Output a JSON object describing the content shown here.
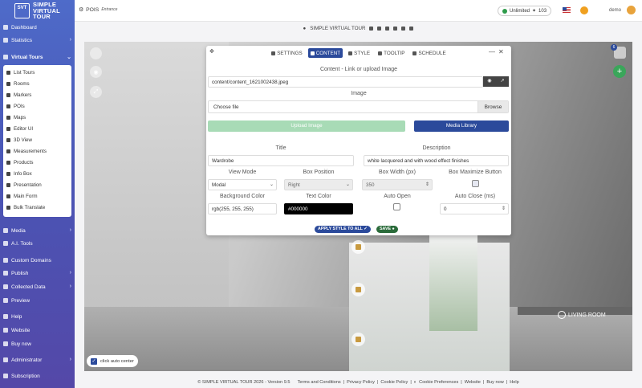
{
  "brand": {
    "logo": "SVT",
    "line1": "SIMPLE",
    "line2": "VIRTUAL",
    "line3": "TOUR"
  },
  "sidebar": {
    "items": [
      {
        "label": "Dashboard",
        "icon": "dashboard-icon"
      },
      {
        "label": "Statistics",
        "icon": "statistics-icon"
      },
      {
        "label": "Virtual Tours",
        "icon": "virtual-tours-icon"
      },
      {
        "label": "Media",
        "icon": "media-icon"
      },
      {
        "label": "A.I. Tools",
        "icon": "ai-tools-icon"
      },
      {
        "label": "Custom Domains",
        "icon": "globe-icon"
      },
      {
        "label": "Publish",
        "icon": "publish-icon"
      },
      {
        "label": "Collected Data",
        "icon": "collected-data-icon"
      },
      {
        "label": "Preview",
        "icon": "eye-icon"
      },
      {
        "label": "Help",
        "icon": "help-icon"
      },
      {
        "label": "Website",
        "icon": "website-icon"
      },
      {
        "label": "Buy now",
        "icon": "cart-icon"
      },
      {
        "label": "Administrator",
        "icon": "administrator-icon"
      },
      {
        "label": "Subscription",
        "icon": "subscription-icon"
      }
    ],
    "submenu": [
      "List Tours",
      "Rooms",
      "Markers",
      "POIs",
      "Maps",
      "Editor UI",
      "3D View",
      "Measurements",
      "Products",
      "Info Box",
      "Presentation",
      "Main Form",
      "Bulk Translate"
    ]
  },
  "topbar": {
    "section": "POIS",
    "subsection": "Entrance",
    "plan": "Unlimited",
    "credits": "103",
    "username": "demo"
  },
  "tourbar": {
    "tour_name": "SIMPLE VIRTUAL TOUR"
  },
  "stage": {
    "room_label": "LIVING ROOM",
    "auto_center_label": "click auto center",
    "badge_count": "6"
  },
  "modal": {
    "tabs": [
      "SETTINGS",
      "CONTENT",
      "STYLE",
      "TOOLTIP",
      "SCHEDULE"
    ],
    "active_tab": "CONTENT",
    "content_heading": "Content - Link or upload Image",
    "content_path": "content/content_1621002438.jpeg",
    "image_heading": "Image",
    "file_placeholder": "Choose file",
    "browse_label": "Browse",
    "upload_label": "Upload Image",
    "media_library_label": "Media Library",
    "title_label": "Title",
    "title_value": "Wardrobe",
    "description_label": "Description",
    "description_value": "white lacquered and with wood effect finishes",
    "view_mode_label": "View Mode",
    "view_mode_value": "Modal",
    "box_position_label": "Box Position",
    "box_position_value": "Right",
    "box_width_label": "Box Width (px)",
    "box_width_value": "350",
    "box_maximize_label": "Box Maximize Button",
    "bg_color_label": "Background Color",
    "bg_color_value": "rgb(255, 255, 255)",
    "text_color_label": "Text Color",
    "text_color_value": "#000000",
    "auto_open_label": "Auto Open",
    "auto_close_label": "Auto Close (ms)",
    "auto_close_value": "0",
    "apply_style_label": "APPLY STYLE TO ALL",
    "save_label": "SAVE"
  },
  "footer": {
    "copyright": "© SIMPLE VIRTUAL TOUR 2026 - Version 9.5",
    "links": [
      "Terms and Conditions",
      "Privacy Policy",
      "Cookie Policy",
      "Cookie Preferences",
      "Website",
      "Buy now",
      "Help"
    ]
  },
  "colors": {
    "accent": "#2b4a9b",
    "upload_button": "#a8dbb6",
    "save_green": "#2a6b3a",
    "sidebar_gradient": [
      "#4e6bc9",
      "#5448a8"
    ]
  }
}
